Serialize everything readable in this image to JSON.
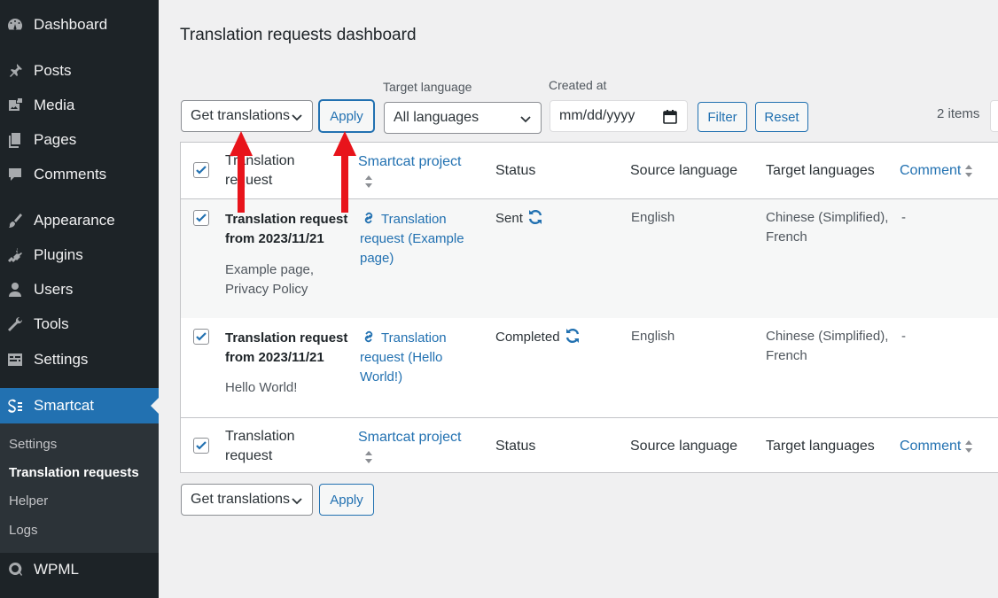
{
  "sidebar": {
    "items": [
      {
        "label": "Dashboard",
        "icon": "dashboard-icon"
      },
      {
        "label": "Posts",
        "icon": "pin-icon"
      },
      {
        "label": "Media",
        "icon": "media-icon"
      },
      {
        "label": "Pages",
        "icon": "pages-icon"
      },
      {
        "label": "Comments",
        "icon": "comments-icon"
      },
      {
        "label": "Appearance",
        "icon": "brush-icon"
      },
      {
        "label": "Plugins",
        "icon": "plug-icon"
      },
      {
        "label": "Users",
        "icon": "user-icon"
      },
      {
        "label": "Tools",
        "icon": "wrench-icon"
      },
      {
        "label": "Settings",
        "icon": "settings-icon"
      },
      {
        "label": "Smartcat",
        "icon": "smartcat-icon"
      },
      {
        "label": "WPML",
        "icon": "wpml-icon"
      }
    ],
    "submenu": [
      "Settings",
      "Translation requests",
      "Helper",
      "Logs"
    ]
  },
  "page": {
    "title": "Translation requests dashboard"
  },
  "toolbar": {
    "bulk_action": "Get translations",
    "apply_label": "Apply",
    "target_language_label": "Target language",
    "target_language_value": "All languages",
    "created_at_label": "Created at",
    "date_placeholder": "mm/dd/yyyy",
    "filter_label": "Filter",
    "reset_label": "Reset",
    "items_count": "2 items"
  },
  "table": {
    "columns": [
      "Translation request",
      "Smartcat project",
      "Status",
      "Source language",
      "Target languages",
      "Comment"
    ],
    "rows": [
      {
        "title": "Translation request from 2023/11/21",
        "pages": "Example page, Privacy Policy",
        "project": "Translation request (Example page)",
        "status": "Sent",
        "source": "English",
        "targets": "Chinese (Simplified), French",
        "comment": "-"
      },
      {
        "title": "Translation request from 2023/11/21",
        "pages": "Hello World!",
        "project": "Translation request (Hello World!)",
        "status": "Completed",
        "source": "English",
        "targets": "Chinese (Simplified), French",
        "comment": "-"
      }
    ]
  },
  "colors": {
    "accent": "#2271b1",
    "sidebar_bg": "#1d2327",
    "arrow": "#e8141b"
  }
}
